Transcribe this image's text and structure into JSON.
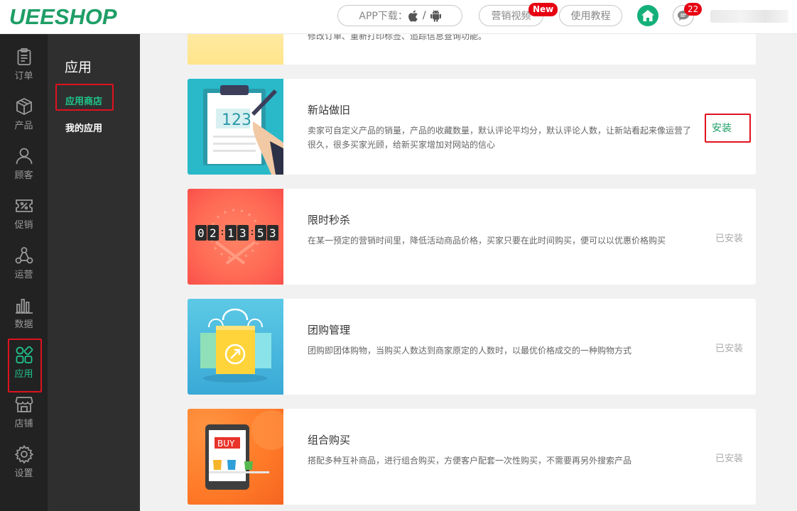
{
  "header": {
    "logo": "UEESHOP",
    "app_download": "APP下载：",
    "app_sep": "/",
    "marketing_video": "营销视频",
    "new_badge": "New",
    "tutorial": "使用教程",
    "message_count": "22"
  },
  "nav": {
    "items": [
      {
        "label": "订单",
        "icon": "order-icon"
      },
      {
        "label": "产品",
        "icon": "product-box-icon"
      },
      {
        "label": "顾客",
        "icon": "customer-icon"
      },
      {
        "label": "促销",
        "icon": "promotion-ticket-icon"
      },
      {
        "label": "运营",
        "icon": "operation-icon"
      },
      {
        "label": "数据",
        "icon": "data-chart-icon"
      },
      {
        "label": "应用",
        "icon": "apps-icon"
      },
      {
        "label": "店铺",
        "icon": "store-icon"
      },
      {
        "label": "设置",
        "icon": "gear-icon"
      }
    ]
  },
  "subnav": {
    "title": "应用",
    "app_store": "应用商店",
    "my_apps": "我的应用"
  },
  "apps": {
    "partial_desc": "修改订单、重新打印标签、追踪信息查询功能。",
    "items": [
      {
        "title": "新站做旧",
        "desc": "卖家可自定义产品的销量，产品的收藏数量，默认评论平均分，默认评论人数，让新站看起来像运营了很久，很多买家光顾，给新买家增加对网站的信心",
        "action": "安装"
      },
      {
        "title": "限时秒杀",
        "desc": "在某一预定的营销时间里，降低活动商品价格，买家只要在此时间购买，便可以以优惠价格购买",
        "action": "已安装"
      },
      {
        "title": "团购管理",
        "desc": "团购即团体购物，当购买人数达到商家原定的人数时，以最优价格成交的一种购物方式",
        "action": "已安装"
      },
      {
        "title": "组合购买",
        "desc": "搭配多种互补商品，进行组合购买，方便客户配套一次性购买，不需要再另外搜索产品",
        "action": "已安装"
      }
    ],
    "clipboard_number": "123",
    "timer_digits": [
      "0",
      "2",
      "1",
      "3",
      "5",
      "3"
    ],
    "buy_label": "BUY"
  },
  "colors": {
    "brand": "#1e9e66",
    "accent": "#1fc58b",
    "highlight": "#e0121f"
  }
}
